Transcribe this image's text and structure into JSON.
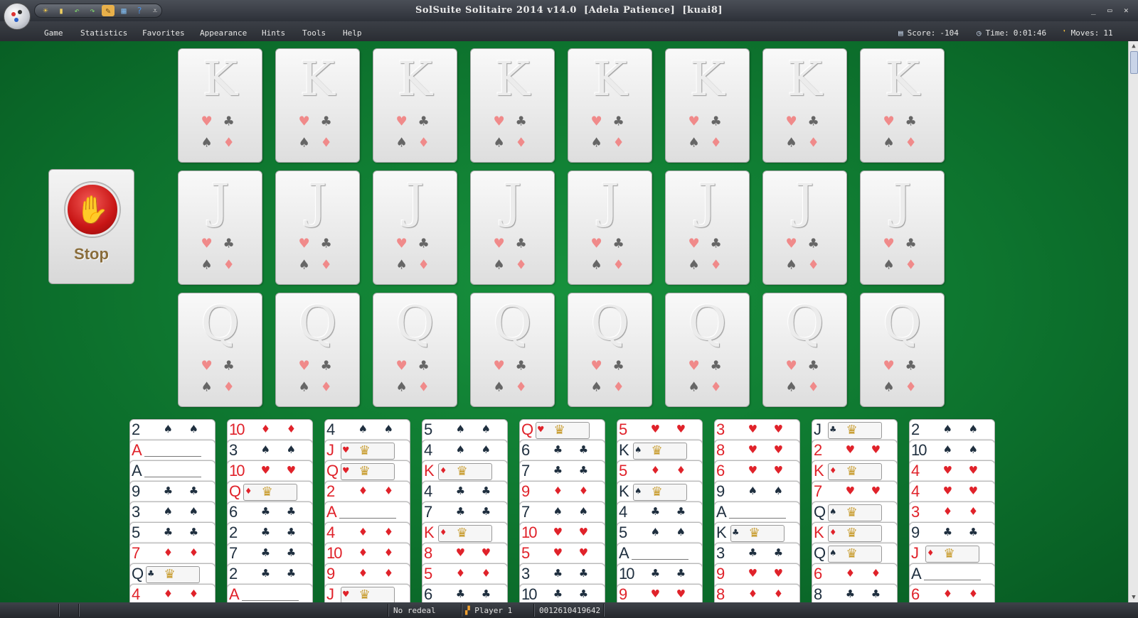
{
  "window": {
    "title": "SolSuite Solitaire 2014 v14.0  [Adela Patience]  [kuai8]",
    "minimize_glyph": "_",
    "maximize_glyph": "▭",
    "close_glyph": "✕"
  },
  "quick_access": [
    {
      "icon": "new-game-icon",
      "glyph": "☀",
      "color": "#f2c94c"
    },
    {
      "icon": "cards-icon",
      "glyph": "▮",
      "color": "#f0d060"
    },
    {
      "icon": "undo-icon",
      "glyph": "↶",
      "color": "#7fd36b"
    },
    {
      "icon": "redo-icon",
      "glyph": "↷",
      "color": "#7fd36b"
    },
    {
      "icon": "hint-icon",
      "glyph": "✎",
      "color": "#6b4a1a"
    },
    {
      "icon": "stats-icon",
      "glyph": "▦",
      "color": "#7ab0e0"
    },
    {
      "icon": "help-icon",
      "glyph": "?",
      "color": "#4a90e2"
    }
  ],
  "qat_overflow": "⩡",
  "menu": [
    "Game",
    "Statistics",
    "Favorites",
    "Appearance",
    "Hints",
    "Tools",
    "Help"
  ],
  "stats": {
    "score_label": "Score:",
    "score": "-104",
    "time_label": "Time:",
    "time": "0:01:46",
    "moves_label": "Moves:",
    "moves": "11"
  },
  "stop_button": {
    "label": "Stop",
    "glyph": "✋"
  },
  "foundation_rows": [
    {
      "rank": "K",
      "count": 8
    },
    {
      "rank": "J",
      "count": 8
    },
    {
      "rank": "Q",
      "count": 8
    }
  ],
  "foundation_pips": [
    "♥",
    "♣",
    "♠",
    "♦"
  ],
  "tableau": [
    [
      [
        "2",
        "♠"
      ],
      [
        "A",
        "♦"
      ],
      [
        "A",
        "♠"
      ],
      [
        "9",
        "♣"
      ],
      [
        "3",
        "♠"
      ],
      [
        "5",
        "♣"
      ],
      [
        "7",
        "♦"
      ],
      [
        "Q",
        "♣"
      ],
      [
        "4",
        "♦"
      ]
    ],
    [
      [
        "10",
        "♦"
      ],
      [
        "3",
        "♠"
      ],
      [
        "10",
        "♥"
      ],
      [
        "Q",
        "♦"
      ],
      [
        "6",
        "♣"
      ],
      [
        "2",
        "♣"
      ],
      [
        "7",
        "♣"
      ],
      [
        "2",
        "♣"
      ],
      [
        "A",
        "♦"
      ]
    ],
    [
      [
        "4",
        "♠"
      ],
      [
        "J",
        "♥"
      ],
      [
        "Q",
        "♥"
      ],
      [
        "2",
        "♦"
      ],
      [
        "A",
        "♦"
      ],
      [
        "4",
        "♦"
      ],
      [
        "10",
        "♦"
      ],
      [
        "9",
        "♦"
      ],
      [
        "J",
        "♥"
      ]
    ],
    [
      [
        "5",
        "♠"
      ],
      [
        "4",
        "♠"
      ],
      [
        "K",
        "♦"
      ],
      [
        "4",
        "♣"
      ],
      [
        "7",
        "♣"
      ],
      [
        "K",
        "♦"
      ],
      [
        "8",
        "♥"
      ],
      [
        "5",
        "♦"
      ],
      [
        "6",
        "♣"
      ]
    ],
    [
      [
        "Q",
        "♥"
      ],
      [
        "6",
        "♣"
      ],
      [
        "7",
        "♣"
      ],
      [
        "9",
        "♦"
      ],
      [
        "7",
        "♠"
      ],
      [
        "10",
        "♥"
      ],
      [
        "5",
        "♥"
      ],
      [
        "3",
        "♣"
      ],
      [
        "10",
        "♣"
      ]
    ],
    [
      [
        "5",
        "♥"
      ],
      [
        "K",
        "♠"
      ],
      [
        "5",
        "♦"
      ],
      [
        "K",
        "♠"
      ],
      [
        "4",
        "♣"
      ],
      [
        "5",
        "♠"
      ],
      [
        "A",
        "♠"
      ],
      [
        "10",
        "♣"
      ],
      [
        "9",
        "♥"
      ]
    ],
    [
      [
        "3",
        "♥"
      ],
      [
        "8",
        "♥"
      ],
      [
        "6",
        "♥"
      ],
      [
        "9",
        "♠"
      ],
      [
        "A",
        "♠"
      ],
      [
        "K",
        "♣"
      ],
      [
        "3",
        "♣"
      ],
      [
        "9",
        "♥"
      ],
      [
        "8",
        "♦"
      ]
    ],
    [
      [
        "J",
        "♣"
      ],
      [
        "2",
        "♥"
      ],
      [
        "K",
        "♦"
      ],
      [
        "7",
        "♥"
      ],
      [
        "Q",
        "♠"
      ],
      [
        "K",
        "♦"
      ],
      [
        "Q",
        "♠"
      ],
      [
        "6",
        "♦"
      ],
      [
        "8",
        "♣"
      ]
    ],
    [
      [
        "2",
        "♠"
      ],
      [
        "10",
        "♠"
      ],
      [
        "4",
        "♥"
      ],
      [
        "4",
        "♥"
      ],
      [
        "3",
        "♦"
      ],
      [
        "9",
        "♣"
      ],
      [
        "J",
        "♦"
      ],
      [
        "A",
        "♠"
      ],
      [
        "6",
        "♦"
      ]
    ]
  ],
  "status": {
    "redeal": "No redeal",
    "player": "Player 1",
    "game_number": "0012610419642"
  }
}
